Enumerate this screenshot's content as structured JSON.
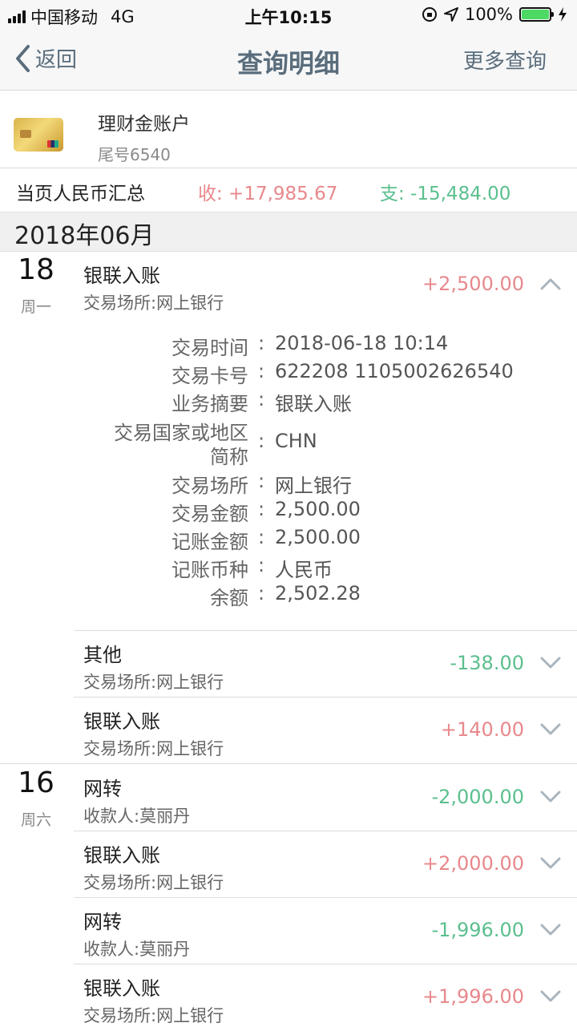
{
  "status": {
    "carrier": "中国移动",
    "network": "4G",
    "time": "上午10:15",
    "battery": "100%",
    "battery_level": 1.0
  },
  "nav": {
    "back": "返回",
    "title": "查询明细",
    "more": "更多查询"
  },
  "account": {
    "name": "理财金账户",
    "tail": "尾号6540"
  },
  "summary": {
    "label": "当页人民币汇总",
    "income": "收: +17,985.67",
    "expense": "支: -15,484.00"
  },
  "month": "2018年06月",
  "colors": {
    "positive": "#e8888c",
    "negative": "#5bbf8e",
    "nav_text": "#5a6d7c"
  },
  "days": [
    {
      "day": "18",
      "weekday": "周一"
    },
    {
      "day": "16",
      "weekday": "周六"
    }
  ],
  "transactions": [
    {
      "title": "银联入账",
      "sub": "交易场所:网上银行",
      "amount": "+2,500.00",
      "expanded": true
    },
    {
      "title": "其他",
      "sub": "交易场所:网上银行",
      "amount": "-138.00",
      "expanded": false
    },
    {
      "title": "银联入账",
      "sub": "交易场所:网上银行",
      "amount": "+140.00",
      "expanded": false
    },
    {
      "title": "网转",
      "sub": "收款人:莫丽丹",
      "amount": "-2,000.00",
      "expanded": false
    },
    {
      "title": "银联入账",
      "sub": "交易场所:网上银行",
      "amount": "+2,000.00",
      "expanded": false
    },
    {
      "title": "网转",
      "sub": "收款人:莫丽丹",
      "amount": "-1,996.00",
      "expanded": false
    },
    {
      "title": "银联入账",
      "sub": "交易场所:网上银行",
      "amount": "+1,996.00",
      "expanded": false
    }
  ],
  "detail": [
    {
      "label": "交易时间",
      "value": "2018-06-18 10:14"
    },
    {
      "label": "交易卡号",
      "value": "622208 1105002626540"
    },
    {
      "label": "业务摘要",
      "value": "银联入账"
    },
    {
      "label": "交易国家或地区",
      "label2": "简称",
      "value": "CHN"
    },
    {
      "label": "交易场所",
      "value": "网上银行"
    },
    {
      "label": "交易金额",
      "value": "2,500.00"
    },
    {
      "label": "记账金额",
      "value": "2,500.00"
    },
    {
      "label": "记账币种",
      "value": "人民币"
    },
    {
      "label": "余额",
      "value": "2,502.28"
    }
  ],
  "detail_colon": ":",
  "icons": {
    "back": "chevron-left-icon",
    "collapse": "chevron-up-icon",
    "expand": "chevron-down-icon"
  }
}
